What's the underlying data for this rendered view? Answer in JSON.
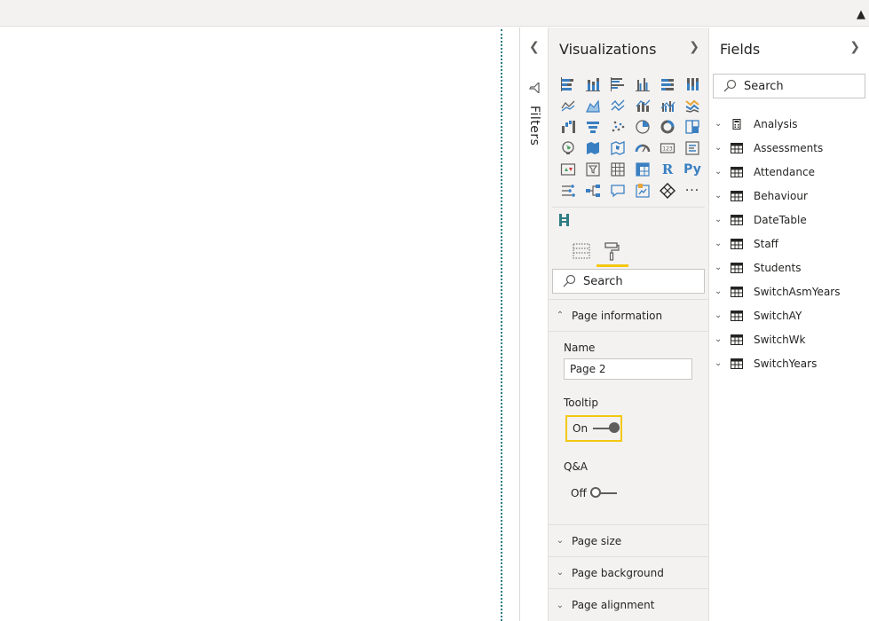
{
  "visualizations": {
    "title": "Visualizations",
    "expand_icon": "chevron-right-icon",
    "build_icons": [
      "stacked-bar-chart-icon",
      "stacked-column-chart-icon",
      "clustered-bar-chart-icon",
      "clustered-column-chart-icon",
      "100-stacked-bar-chart-icon",
      "100-stacked-column-chart-icon",
      "line-chart-icon",
      "area-chart-icon",
      "stacked-area-chart-icon",
      "line-and-column-chart-icon",
      "line-and-clustered-column-chart-icon",
      "ribbon-chart-icon",
      "waterfall-chart-icon",
      "funnel-icon",
      "scatter-chart-icon",
      "pie-chart-icon",
      "donut-chart-icon",
      "treemap-icon",
      "map-icon",
      "filled-map-icon",
      "shape-map-icon",
      "gauge-icon",
      "card-icon",
      "multi-row-card-icon",
      "kpi-icon",
      "slicer-icon",
      "table-icon",
      "matrix-icon",
      "r-visual-icon",
      "python-visual-icon",
      "key-influencers-icon",
      "decomposition-tree-icon",
      "qa-icon",
      "paginated-report-icon",
      "power-apps-icon",
      "more-visuals-icon"
    ],
    "r_label": "R",
    "py_label": "Py",
    "more_label": "···",
    "tabs": [
      "fields-tab",
      "format-tab"
    ],
    "search_placeholder": "Search",
    "sections": {
      "page_information": "Page information",
      "page_size": "Page size",
      "page_background": "Page background",
      "page_alignment": "Page alignment"
    },
    "name_label": "Name",
    "name_value": "Page 2",
    "tooltip_label": "Tooltip",
    "tooltip_state": "On",
    "qa_label": "Q&A",
    "qa_state": "Off"
  },
  "filters": {
    "label": "Filters"
  },
  "fields": {
    "title": "Fields",
    "search_placeholder": "Search",
    "tables": [
      {
        "name": "Analysis",
        "icon": "calculator-icon"
      },
      {
        "name": "Assessments",
        "icon": "table-icon"
      },
      {
        "name": "Attendance",
        "icon": "table-icon"
      },
      {
        "name": "Behaviour",
        "icon": "table-icon"
      },
      {
        "name": "DateTable",
        "icon": "table-icon"
      },
      {
        "name": "Staff",
        "icon": "table-icon"
      },
      {
        "name": "Students",
        "icon": "table-icon"
      },
      {
        "name": "SwitchAsmYears",
        "icon": "table-icon"
      },
      {
        "name": "SwitchAY",
        "icon": "table-icon"
      },
      {
        "name": "SwitchWk",
        "icon": "table-icon"
      },
      {
        "name": "SwitchYears",
        "icon": "table-icon"
      }
    ]
  },
  "colors": {
    "accent": "#f2c811",
    "canvas_edge": "#2e7d82",
    "viz_blue": "#3a7fc1",
    "pane_bg": "#f3f2f1"
  }
}
